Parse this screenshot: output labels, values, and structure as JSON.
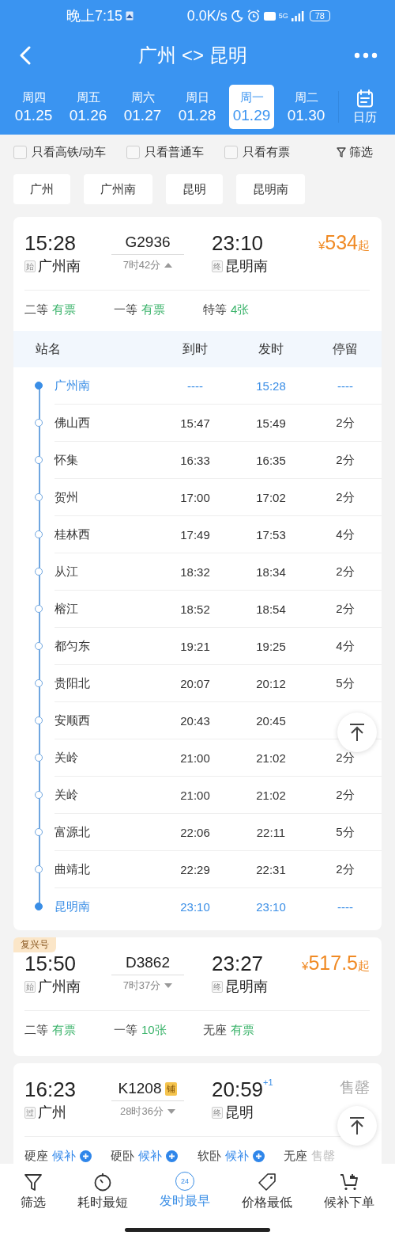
{
  "status_bar": {
    "time": "晚上7:15",
    "speed": "0.0K/s",
    "network": "5G",
    "battery": "78"
  },
  "header": {
    "title": "广州 <> 昆明"
  },
  "dates": [
    {
      "weekday": "周四",
      "date": "01.25",
      "selected": false
    },
    {
      "weekday": "周五",
      "date": "01.26",
      "selected": false
    },
    {
      "weekday": "周六",
      "date": "01.27",
      "selected": false
    },
    {
      "weekday": "周日",
      "date": "01.28",
      "selected": false
    },
    {
      "weekday": "周一",
      "date": "01.29",
      "selected": true
    },
    {
      "weekday": "周二",
      "date": "01.30",
      "selected": false
    }
  ],
  "calendar_button": "日历",
  "filters": [
    {
      "label": "只看高铁/动车",
      "checked": false
    },
    {
      "label": "只看普通车",
      "checked": false
    },
    {
      "label": "只看有票",
      "checked": false
    }
  ],
  "filter_button": "筛选",
  "station_chips": [
    "广州",
    "广州南",
    "昆明",
    "昆明南"
  ],
  "trains": [
    {
      "depart": "15:28",
      "from_tag": "始",
      "from": "广州南",
      "number": "G2936",
      "duration": "7时42分",
      "expanded": true,
      "arrive": "23:10",
      "to_tag": "终",
      "to": "昆明南",
      "price_symbol": "¥",
      "price": "534",
      "price_suffix": "起",
      "seats": [
        {
          "class": "二等",
          "availability": "有票",
          "kind": "available"
        },
        {
          "class": "一等",
          "availability": "有票",
          "kind": "available"
        },
        {
          "class": "特等",
          "availability": "4张",
          "kind": "available"
        }
      ],
      "stop_columns": [
        "站名",
        "到时",
        "发时",
        "停留"
      ],
      "stops": [
        {
          "name": "广州南",
          "arrive": "----",
          "depart": "15:28",
          "stay": "----",
          "kind": "end"
        },
        {
          "name": "佛山西",
          "arrive": "15:47",
          "depart": "15:49",
          "stay": "2分",
          "kind": "stop"
        },
        {
          "name": "怀集",
          "arrive": "16:33",
          "depart": "16:35",
          "stay": "2分",
          "kind": "stop"
        },
        {
          "name": "贺州",
          "arrive": "17:00",
          "depart": "17:02",
          "stay": "2分",
          "kind": "stop"
        },
        {
          "name": "桂林西",
          "arrive": "17:49",
          "depart": "17:53",
          "stay": "4分",
          "kind": "stop"
        },
        {
          "name": "从江",
          "arrive": "18:32",
          "depart": "18:34",
          "stay": "2分",
          "kind": "stop"
        },
        {
          "name": "榕江",
          "arrive": "18:52",
          "depart": "18:54",
          "stay": "2分",
          "kind": "stop"
        },
        {
          "name": "都匀东",
          "arrive": "19:21",
          "depart": "19:25",
          "stay": "4分",
          "kind": "stop"
        },
        {
          "name": "贵阳北",
          "arrive": "20:07",
          "depart": "20:12",
          "stay": "5分",
          "kind": "stop"
        },
        {
          "name": "安顺西",
          "arrive": "20:43",
          "depart": "20:45",
          "kind": "stop"
        },
        {
          "name": "关岭",
          "arrive": "21:00",
          "depart": "21:02",
          "stay": "2分",
          "kind": "stop"
        },
        {
          "name": "关岭",
          "arrive": "21:00",
          "depart": "21:02",
          "stay": "2分",
          "kind": "stop"
        },
        {
          "name": "富源北",
          "arrive": "22:06",
          "depart": "22:11",
          "stay": "5分",
          "kind": "stop"
        },
        {
          "name": "曲靖北",
          "arrive": "22:29",
          "depart": "22:31",
          "stay": "2分",
          "kind": "stop"
        },
        {
          "name": "昆明南",
          "arrive": "23:10",
          "depart": "23:10",
          "stay": "----",
          "kind": "end"
        }
      ]
    },
    {
      "badge": "复兴号",
      "depart": "15:50",
      "from_tag": "始",
      "from": "广州南",
      "number": "D3862",
      "duration": "7时37分",
      "expanded": false,
      "arrive": "23:27",
      "to_tag": "终",
      "to": "昆明南",
      "price_symbol": "¥",
      "price": "517.5",
      "price_suffix": "起",
      "seats": [
        {
          "class": "二等",
          "availability": "有票",
          "kind": "available"
        },
        {
          "class": "一等",
          "availability": "10张",
          "kind": "available"
        },
        {
          "class": "无座",
          "availability": "有票",
          "kind": "available"
        }
      ]
    },
    {
      "depart": "16:23",
      "from_tag": "过",
      "from": "广州",
      "number": "K1208",
      "number_tag": "铺",
      "duration": "28时36分",
      "expanded": false,
      "arrive": "20:59",
      "day_offset": "+1",
      "to_tag": "终",
      "to": "昆明",
      "sold_out": "售罄",
      "seats": [
        {
          "class": "硬座",
          "availability": "候补",
          "kind": "waitlist"
        },
        {
          "class": "硬卧",
          "availability": "候补",
          "kind": "waitlist"
        },
        {
          "class": "软卧",
          "availability": "候补",
          "kind": "waitlist"
        },
        {
          "class": "无座",
          "availability": "售罄",
          "kind": "soldout"
        }
      ]
    }
  ],
  "bottom_nav": [
    {
      "label": "筛选",
      "selected": false
    },
    {
      "label": "耗时最短",
      "selected": false
    },
    {
      "label": "发时最早",
      "selected": true,
      "icon_text": "24"
    },
    {
      "label": "价格最低",
      "selected": false
    },
    {
      "label": "候补下单",
      "selected": false
    }
  ]
}
